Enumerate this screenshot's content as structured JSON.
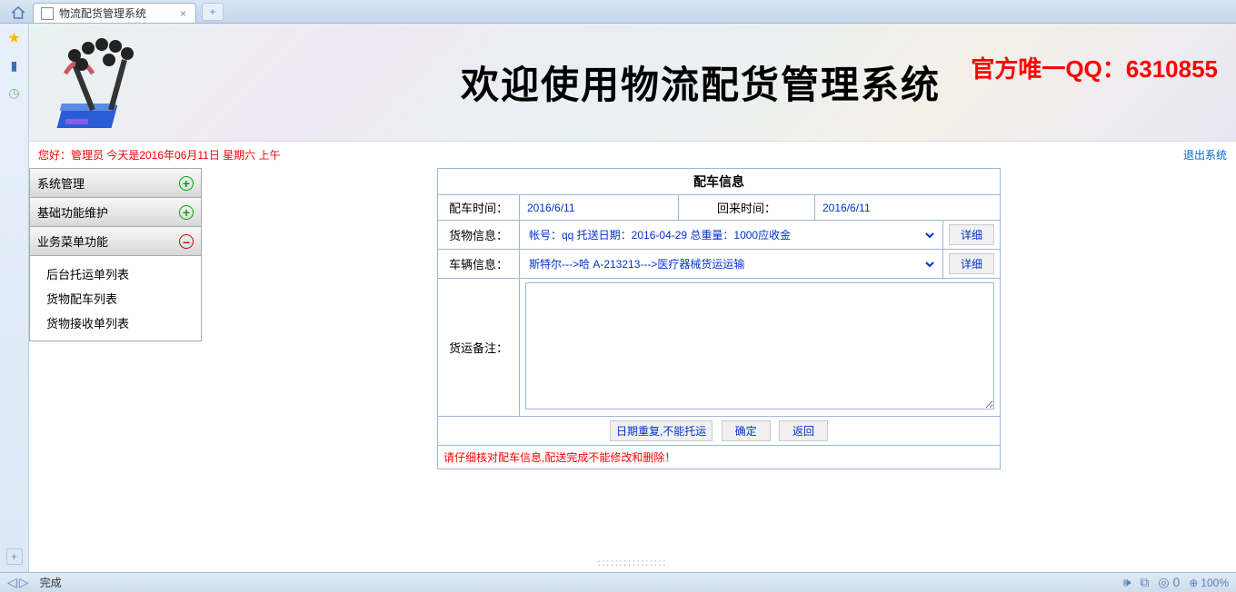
{
  "browser": {
    "tab_title": "物流配货管理系统",
    "status_text": "完成",
    "zoom": "100%",
    "shield_count": "0"
  },
  "banner": {
    "title": "欢迎使用物流配货管理系统",
    "watermark": "官方唯一QQ：6310855"
  },
  "infobar": {
    "greeting": "您好：管理员  今天是2016年06月11日   星期六   上午",
    "logout": "退出系统"
  },
  "menu": {
    "sys": "系统管理",
    "base": "基础功能维护",
    "biz": "业务菜单功能",
    "items": {
      "consign": "后台托运单列表",
      "dispatch": "货物配车列表",
      "receive": "货物接收单列表"
    }
  },
  "form": {
    "title": "配车信息",
    "labels": {
      "dispatch_time": "配车时间：",
      "return_time": "回来时间：",
      "cargo_info": "货物信息：",
      "vehicle_info": "车辆信息：",
      "remark": "货运备注："
    },
    "values": {
      "dispatch_time": "2016/6/11",
      "return_time": "2016/6/11",
      "cargo_info": "帐号：qq 托送日期：2016-04-29 总重量：1000应收金",
      "vehicle_info": "斯特尔--->哈 A-213213--->医疗器械货运运输"
    },
    "buttons": {
      "detail": "详细",
      "msg": "日期重复,不能托运",
      "confirm": "确定",
      "back": "返回"
    },
    "warning": "请仔细核对配车信息,配送完成不能修改和删除！"
  }
}
